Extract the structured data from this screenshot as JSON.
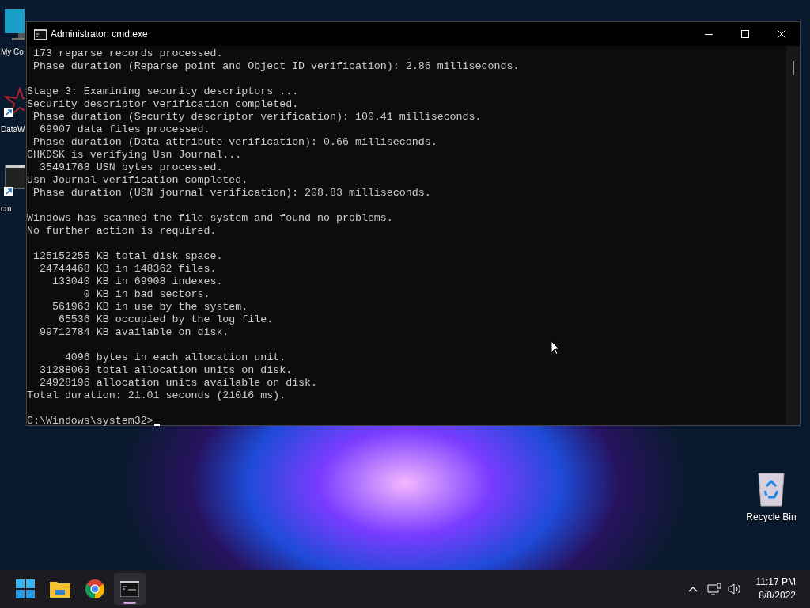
{
  "desktop_icons": [
    {
      "kind": "computer",
      "label": "My Co"
    },
    {
      "kind": "app",
      "label": "DataW"
    },
    {
      "kind": "console",
      "label": "cm"
    }
  ],
  "recycle_bin": {
    "label": "Recycle Bin"
  },
  "window": {
    "title": "Administrator: cmd.exe",
    "console": {
      "blocks": [
        [
          " 173 reparse records processed.",
          " Phase duration (Reparse point and Object ID verification): 2.86 milliseconds."
        ],
        [
          "Stage 3: Examining security descriptors ...",
          "Security descriptor verification completed.",
          " Phase duration (Security descriptor verification): 100.41 milliseconds.",
          "  69907 data files processed.",
          " Phase duration (Data attribute verification): 0.66 milliseconds.",
          "CHKDSK is verifying Usn Journal...",
          "  35491768 USN bytes processed.",
          "Usn Journal verification completed.",
          " Phase duration (USN journal verification): 208.83 milliseconds."
        ],
        [
          "Windows has scanned the file system and found no problems.",
          "No further action is required."
        ],
        [
          " 125152255 KB total disk space.",
          "  24744468 KB in 148362 files.",
          "    133040 KB in 69908 indexes.",
          "         0 KB in bad sectors.",
          "    561963 KB in use by the system.",
          "     65536 KB occupied by the log file.",
          "  99712784 KB available on disk."
        ],
        [
          "      4096 bytes in each allocation unit.",
          "  31288063 total allocation units on disk.",
          "  24928196 allocation units available on disk.",
          "Total duration: 21.01 seconds (21016 ms)."
        ]
      ],
      "prompt": "C:\\Windows\\system32>"
    }
  },
  "taskbar": {
    "apps": [
      {
        "kind": "start",
        "selected": false
      },
      {
        "kind": "explorer",
        "selected": false
      },
      {
        "kind": "browser",
        "selected": false
      },
      {
        "kind": "terminal",
        "selected": true
      }
    ],
    "time": "11:17 PM",
    "date": "8/8/2022"
  }
}
